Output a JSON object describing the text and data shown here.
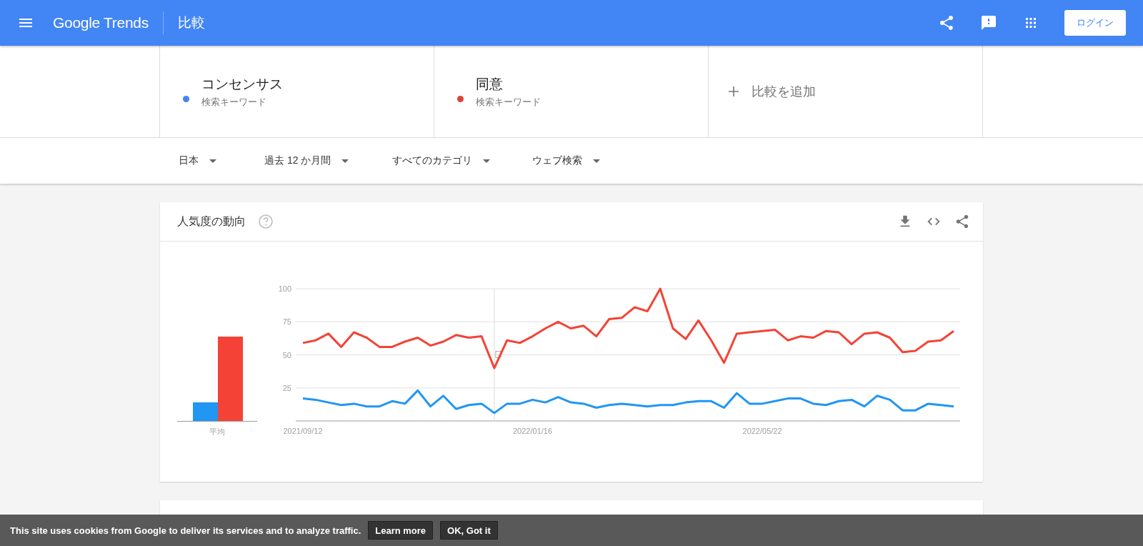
{
  "header": {
    "logo": "Google Trends",
    "page_title": "比較",
    "login_button": "ログイン"
  },
  "terms": [
    {
      "name": "コンセンサス",
      "subtitle": "検索キーワード",
      "color": "#4285f4"
    },
    {
      "name": "同意",
      "subtitle": "検索キーワード",
      "color": "#db4437"
    }
  ],
  "add_compare": "比較を追加",
  "filters": [
    {
      "label": "日本"
    },
    {
      "label": "過去 12 か月間"
    },
    {
      "label": "すべてのカテゴリ"
    },
    {
      "label": "ウェブ検索"
    }
  ],
  "trend_card": {
    "title": "人気度の動向",
    "average_label": "平均",
    "chart_data": {
      "type": "line",
      "categories": [
        "2021/09/12",
        null,
        null,
        null,
        null,
        null,
        null,
        null,
        null,
        null,
        null,
        null,
        null,
        null,
        null,
        null,
        null,
        null,
        "2022/01/16",
        null,
        null,
        null,
        null,
        null,
        null,
        null,
        null,
        null,
        null,
        null,
        null,
        null,
        null,
        null,
        null,
        null,
        "2022/05/22",
        null,
        null,
        null,
        null,
        null,
        null,
        null,
        null,
        null,
        null,
        null,
        null,
        null,
        null,
        null
      ],
      "series": [
        {
          "color": "#2196f3",
          "values": [
            17,
            16,
            14,
            12,
            13,
            11,
            11,
            15,
            13,
            23,
            11,
            19,
            9,
            12,
            13,
            6,
            13,
            13,
            16,
            14,
            18,
            14,
            13,
            10,
            12,
            13,
            12,
            11,
            12,
            12,
            14,
            15,
            15,
            10,
            21,
            13,
            13,
            15,
            17,
            17,
            13,
            12,
            15,
            16,
            11,
            19,
            16,
            8,
            8,
            13,
            12,
            11
          ]
        },
        {
          "color": "#f44336",
          "values": [
            59,
            61,
            66,
            56,
            67,
            63,
            56,
            56,
            60,
            63,
            57,
            60,
            65,
            63,
            64,
            40,
            61,
            59,
            64,
            70,
            75,
            70,
            72,
            64,
            77,
            78,
            86,
            83,
            100,
            70,
            62,
            76,
            61,
            44,
            66,
            67,
            68,
            69,
            61,
            64,
            63,
            68,
            67,
            58,
            66,
            67,
            63,
            52,
            53,
            60,
            61,
            68
          ]
        }
      ],
      "ylim": [
        0,
        100
      ],
      "yticks": [
        25,
        50,
        75,
        100
      ],
      "grid": true
    }
  },
  "cookie_bar": {
    "text": "This site uses cookies from Google to deliver its services and to analyze traffic.",
    "buttons": [
      "Learn more",
      "OK, Got it"
    ]
  }
}
